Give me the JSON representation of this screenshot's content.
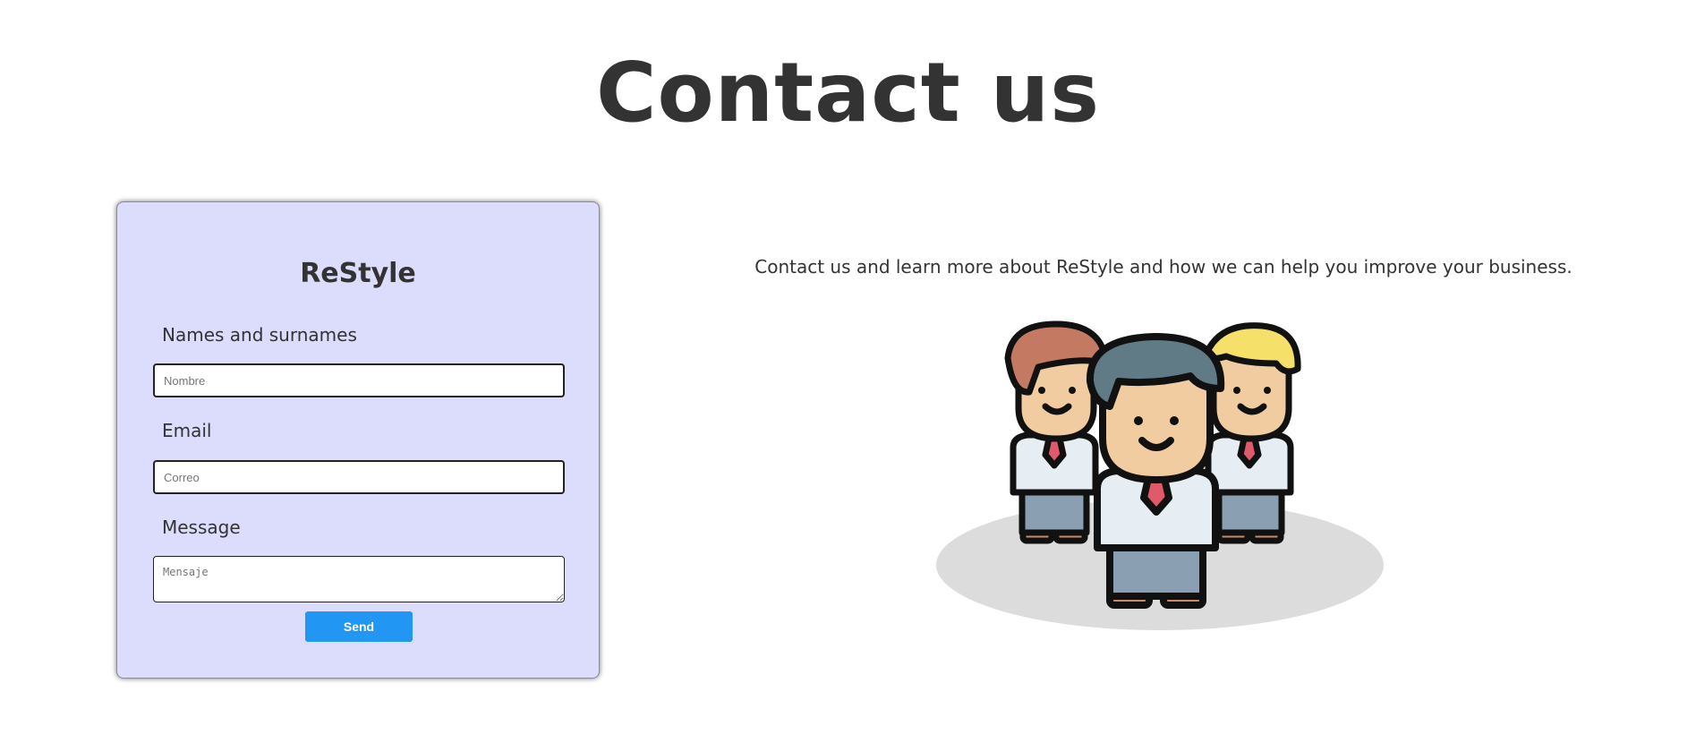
{
  "page": {
    "title": "Contact us"
  },
  "form": {
    "brand": "ReStyle",
    "name_label": "Names and surnames",
    "name_placeholder": "Nombre",
    "email_label": "Email",
    "email_placeholder": "Correo",
    "message_label": "Message",
    "message_placeholder": "Mensaje",
    "send_label": "Send"
  },
  "info": {
    "text": "Contact us and learn more about ReStyle and how we can help you improve your business."
  },
  "illustration": {
    "icon": "team-of-businessmen-illustration"
  },
  "colors": {
    "card_background": "#dcdcfc",
    "button": "#2196f3",
    "text": "#333333"
  }
}
